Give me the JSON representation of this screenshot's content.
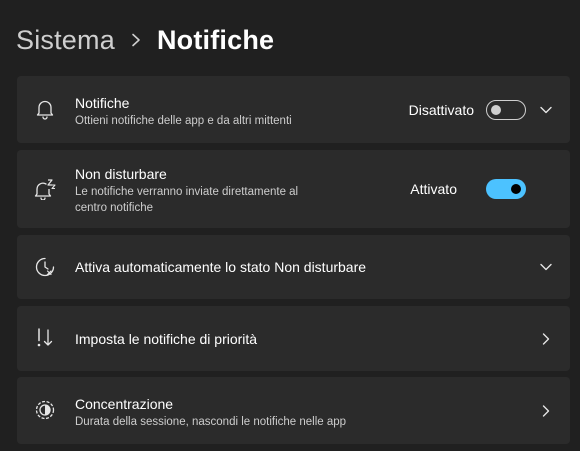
{
  "breadcrumb": {
    "parent": "Sistema",
    "current": "Notifiche"
  },
  "cards": {
    "notifiche": {
      "title": "Notifiche",
      "subtitle": "Ottieni notifiche delle app e da altri mittenti",
      "state": "Disattivato",
      "toggle_on": false,
      "icon": "bell-icon"
    },
    "non_disturbare": {
      "title": "Non disturbare",
      "subtitle_line1": "Le notifiche verranno inviate direttamente al",
      "subtitle_line2": "centro notifiche",
      "state": "Attivato",
      "toggle_on": true,
      "icon": "bell-snooze-icon"
    },
    "attiva_auto": {
      "title": "Attiva automaticamente lo stato Non disturbare",
      "icon": "clock-icon"
    },
    "priorita": {
      "title": "Imposta le notifiche di priorità",
      "icon": "priority-icon"
    },
    "concentrazione": {
      "title": "Concentrazione",
      "subtitle": "Durata della sessione, nascondi le notifiche nelle app",
      "icon": "focus-icon"
    }
  },
  "colors": {
    "background": "#202020",
    "card": "#2b2b2b",
    "accent": "#4cc2ff"
  }
}
